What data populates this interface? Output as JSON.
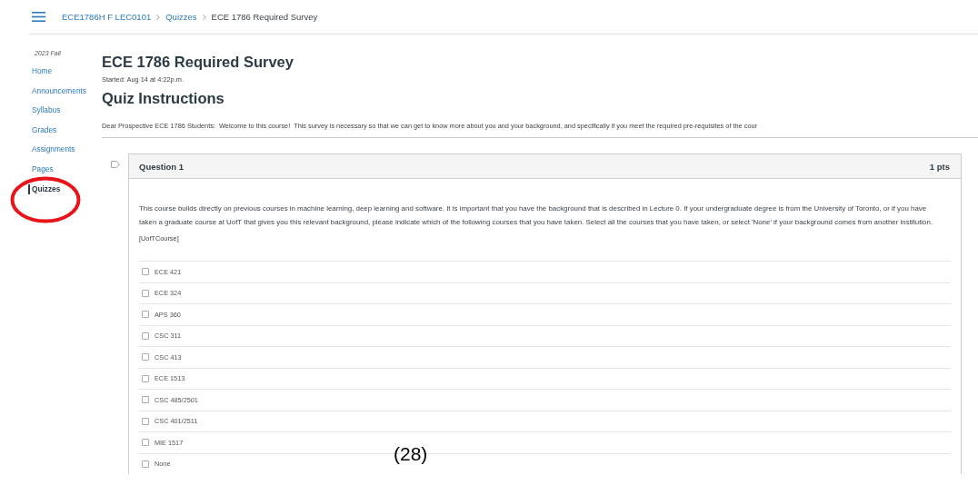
{
  "breadcrumbs": [
    {
      "label": "ECE1786H F LEC0101",
      "current": false
    },
    {
      "label": "Quizzes",
      "current": false
    },
    {
      "label": "ECE 1786 Required Survey",
      "current": true
    }
  ],
  "sidebar": {
    "term": "2023 Fall",
    "items": [
      {
        "label": "Home",
        "selected": false
      },
      {
        "label": "Announcements",
        "selected": false
      },
      {
        "label": "Syllabus",
        "selected": false
      },
      {
        "label": "Grades",
        "selected": false
      },
      {
        "label": "Assignments",
        "selected": false
      },
      {
        "label": "Pages",
        "selected": false
      },
      {
        "label": "Quizzes",
        "selected": true
      }
    ]
  },
  "quiz": {
    "title": "ECE 1786 Required Survey",
    "started": "Started: Aug 14 at 4:22p.m.",
    "instructions_heading": "Quiz Instructions",
    "instructions": "Dear Prospective ECE 1786 Students:  Welcome to this course!  This survey is necessary so that we can get to know more about you and your background, and specifically if you meet the required pre-requisites of the cour"
  },
  "question": {
    "title": "Question 1",
    "points": "1 pts",
    "text": "This course builds directly on previous courses in machine learning, deep learning and software.  It is important that you have the background that is described in Lecture 0.  If your undergraduate degree is from the University of Toronto, or if you have taken a graduate course at UofT that gives you this relevant background, please indicate which of the following courses that you have taken.  Select all the courses that you have taken, or select 'None' if your background comes from another institution.",
    "tag": "[UofTCourse]",
    "options": [
      {
        "label": "ECE 421",
        "checked": false
      },
      {
        "label": "ECE 324",
        "checked": false
      },
      {
        "label": "APS 360",
        "checked": false
      },
      {
        "label": "CSC 311",
        "checked": false
      },
      {
        "label": "CSC 413",
        "checked": false
      },
      {
        "label": "ECE 1513",
        "checked": false
      },
      {
        "label": "CSC 485/2501",
        "checked": false
      },
      {
        "label": "CSC 401/2511",
        "checked": false
      },
      {
        "label": "MIE 1517",
        "checked": false
      },
      {
        "label": "None",
        "checked": false
      }
    ]
  },
  "annotation": {
    "figure_label": "(28)"
  }
}
